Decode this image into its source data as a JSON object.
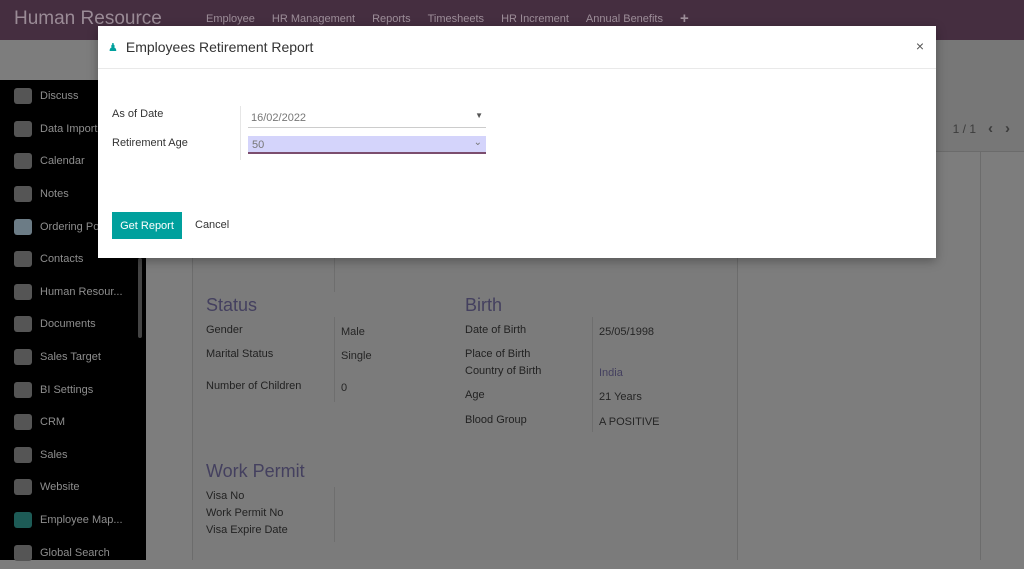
{
  "app": {
    "title": "Human Resource",
    "menu": [
      "Employee",
      "HR Management",
      "Reports",
      "Timesheets",
      "HR Increment",
      "Annual Benefits",
      "+"
    ]
  },
  "sidebar": {
    "items": [
      {
        "label": "Discuss",
        "icon": "camera-icon"
      },
      {
        "label": "Data Import",
        "icon": "camera-icon"
      },
      {
        "label": "Calendar",
        "icon": "camera-icon"
      },
      {
        "label": "Notes",
        "icon": "camera-icon"
      },
      {
        "label": "Ordering Po",
        "icon": "handshake-icon"
      },
      {
        "label": "Contacts",
        "icon": "camera-icon"
      },
      {
        "label": "Human Resour...",
        "icon": "camera-icon"
      },
      {
        "label": "Documents",
        "icon": "camera-icon"
      },
      {
        "label": "Sales Target",
        "icon": "camera-icon"
      },
      {
        "label": "BI Settings",
        "icon": "camera-icon"
      },
      {
        "label": "CRM",
        "icon": "camera-icon"
      },
      {
        "label": "Sales",
        "icon": "camera-icon"
      },
      {
        "label": "Website",
        "icon": "camera-icon"
      },
      {
        "label": "Employee Map...",
        "icon": "map-pin-icon"
      },
      {
        "label": "Global Search",
        "icon": "camera-icon"
      }
    ]
  },
  "pager": {
    "value": "1 / 1"
  },
  "form": {
    "status": {
      "title": "Status",
      "gender_label": "Gender",
      "gender": "Male",
      "marital_label": "Marital Status",
      "marital": "Single",
      "children_label": "Number of Children",
      "children": "0"
    },
    "birth": {
      "title": "Birth",
      "dob_label": "Date of Birth",
      "dob": "25/05/1998",
      "place_label": "Place of Birth",
      "country_label": "Country of Birth",
      "country": "India",
      "age_label": "Age",
      "age": "21 Years",
      "blood_label": "Blood Group",
      "blood": "A POSITIVE"
    },
    "permit": {
      "title": "Work Permit",
      "visa_label": "Visa No",
      "permit_label": "Work Permit No",
      "expire_label": "Visa Expire Date"
    }
  },
  "modal": {
    "title": "Employees Retirement Report",
    "close": "×",
    "date_label": "As of Date",
    "date_value": "16/02/2022",
    "age_label": "Retirement Age",
    "age_value": "50",
    "get_report": "Get Report",
    "cancel": "Cancel"
  },
  "colors": {
    "accent": "#00a09d",
    "topbar": "#452e40",
    "select_bg": "#d4d4fb"
  }
}
